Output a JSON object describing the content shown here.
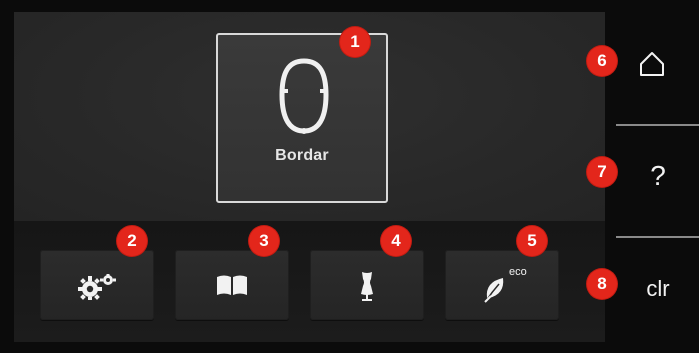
{
  "screen": {
    "embroidery_tile": {
      "label": "Bordar"
    },
    "bottom_buttons": [
      {
        "icon": "settings-gears-icon"
      },
      {
        "icon": "book-open-icon"
      },
      {
        "icon": "dress-form-icon"
      },
      {
        "icon": "eco-leaf-icon",
        "badge_text": "eco"
      }
    ],
    "side_buttons": {
      "home": {
        "icon": "home-icon"
      },
      "help": {
        "label": "?"
      },
      "clear": {
        "label": "clr"
      }
    }
  },
  "callouts": [
    "1",
    "2",
    "3",
    "4",
    "5",
    "6",
    "7",
    "8"
  ],
  "colors": {
    "callout_red": "#e3261b",
    "tile_border": "#d9d9d9",
    "background": "#0b0b0b"
  }
}
